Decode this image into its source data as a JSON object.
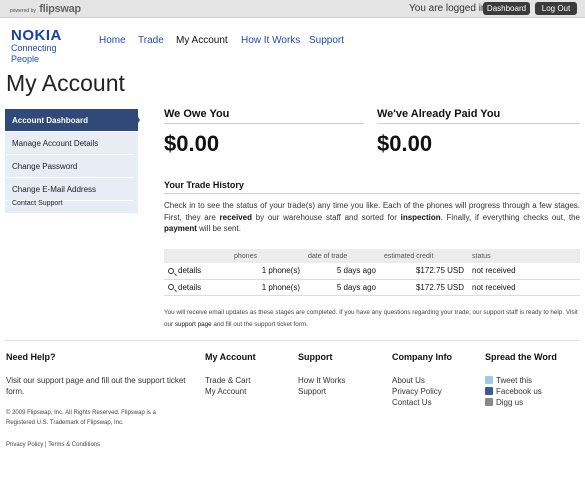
{
  "topbar": {
    "powered_by": "powered by",
    "brand": "flipswap",
    "status": "You are logged in!",
    "dashboard_label": "Dashboard",
    "logout_label": "Log Out"
  },
  "logo": {
    "main": "NOKIA",
    "tagline": "Connecting People"
  },
  "nav": {
    "home": "Home",
    "trade": "Trade",
    "account": "My Account",
    "how": "How It Works",
    "support": "Support"
  },
  "page_title": "My Account",
  "sidebar": {
    "items": [
      {
        "label": "Account Dashboard"
      },
      {
        "label": "Manage Account Details"
      },
      {
        "label": "Change Password"
      },
      {
        "label": "Change E-Mail Address"
      },
      {
        "label": "Contact Support"
      }
    ]
  },
  "summary": {
    "owe_title": "We Owe You",
    "owe_amount": "$0.00",
    "paid_title": "We've Already Paid You",
    "paid_amount": "$0.00"
  },
  "history": {
    "title": "Your Trade History",
    "desc_1": "Check in to see the status of your trade(s) any time you like. Each of the phones will progress through a few stages. First, they are ",
    "desc_received": "received",
    "desc_2": " by our warehouse staff and sorted for ",
    "desc_inspection": "inspection",
    "desc_3": ". Finally, if everything checks out, the ",
    "desc_payment": "payment",
    "desc_4": " will be sent.",
    "columns": {
      "c0": "",
      "phones": "phones",
      "date": "date of trade",
      "credit": "estimated credit",
      "status": "status"
    },
    "rows": [
      {
        "link": "details",
        "phones": "1 phone(s)",
        "date": "5 days ago",
        "credit": "$172.75 USD",
        "status": "not received"
      },
      {
        "link": "details",
        "phones": "1 phone(s)",
        "date": "5 days ago",
        "credit": "$172.75 USD",
        "status": "not received"
      }
    ],
    "notice_1": "You will receive email updates as these stages are completed. If you have any questions regarding your trade, our support staff is ready to help. Visit our ",
    "notice_link": "support page",
    "notice_2": " and fill out the support ticket form."
  },
  "footer": {
    "help_title": "Need Help?",
    "help_text": "Visit our support page and fill out the support ticket form.",
    "copyright": "© 2009 Flipswap, Inc. All Rights Reserved. Flipswap is a Registered U.S. Trademark of Flipswap, Inc.",
    "legal": "Privacy Policy | Terms & Conditions",
    "account_title": "My Account",
    "account_links": [
      "Trade & Cart",
      "My Account"
    ],
    "support_title": "Support",
    "support_links": [
      "How It Works",
      "Support"
    ],
    "company_title": "Company Info",
    "company_links": [
      "About Us",
      "Privacy Policy",
      "Contact Us"
    ],
    "spread_title": "Spread the Word",
    "spread_links": [
      {
        "label": "Tweet this",
        "icon": "twitter-icon"
      },
      {
        "label": "Facebook us",
        "icon": "facebook-icon"
      },
      {
        "label": "Digg us",
        "icon": "digg-icon"
      }
    ]
  }
}
